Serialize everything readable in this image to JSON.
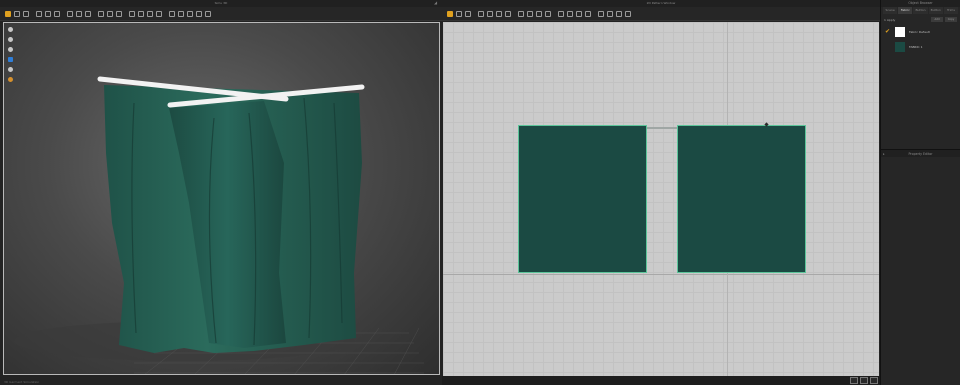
{
  "panels": {
    "view3d": {
      "title": "Simu 3D",
      "status": "3D Garment Simulation"
    },
    "view2d": {
      "title": "2D Pattern Window"
    },
    "object_browser": {
      "title": "Object Browser",
      "tabs": [
        "Scene",
        "Fabric",
        "Button",
        "Button",
        "Trims"
      ],
      "active_tab": 1,
      "filter_label": "1 Apply",
      "filter_buttons": [
        "Add",
        "Copy"
      ],
      "items": [
        {
          "label": "Fabric Default",
          "color": "#ffffff",
          "checked": true
        },
        {
          "label": "FABRIC 1",
          "color": "#1b4a43",
          "checked": false
        }
      ]
    },
    "property_editor": {
      "title": "Property Editor"
    }
  },
  "colors": {
    "fabric": "#1b4a43",
    "seam": "#5cc59a",
    "accent": "#e0a11f",
    "pole": "#f2f2f2"
  },
  "icons": {
    "toolbar": [
      "select-icon",
      "move-icon",
      "rotate-icon",
      "pin-icon",
      "fold-icon",
      "measure-icon",
      "avatar-icon",
      "sewing-icon",
      "arrangement-icon",
      "texture-icon",
      "camera-icon",
      "light-icon"
    ],
    "side_tools": [
      "display-avatar-icon",
      "display-garment-icon",
      "display-avatar-measure-icon",
      "render-icon",
      "avatar-skin-icon",
      "light-bulb-icon"
    ]
  }
}
